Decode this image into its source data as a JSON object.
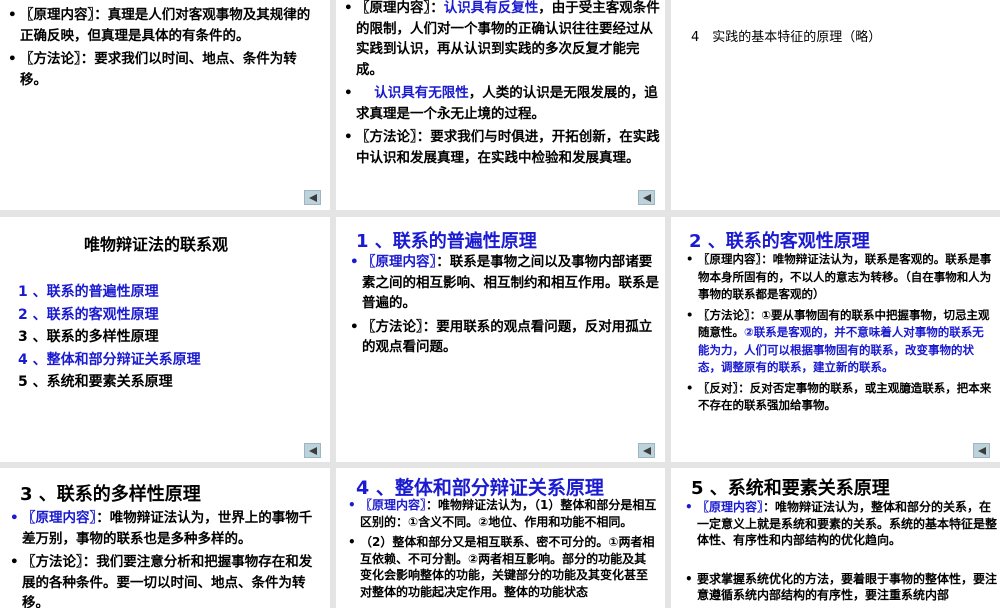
{
  "slides": [
    {
      "bullets": [
        [
          {
            "t": "〖原理内容〗：真理是人们对客观事物及其规律的正确反映，但真理是具体的有条件的。",
            "b": false
          }
        ],
        [
          {
            "t": "〖方法论〗：要求我们以时间、地点、条件为转移。",
            "b": false
          }
        ]
      ]
    },
    {
      "bullets": [
        [
          {
            "t": "〖原理内容〗：",
            "b": false
          },
          {
            "t": "认识具有反复性",
            "b": true
          },
          {
            "t": "，由于受主客观条件的限制，人们对一个事物的正确认识往往要经过从实践到认识，再从认识到实践的多次反复才能完成。",
            "b": false
          }
        ],
        [
          {
            "t": "　 ",
            "b": false
          },
          {
            "t": "认识具有无限性",
            "b": true
          },
          {
            "t": "，人类的认识是无限发展的，追求真理是一个永无止境的过程。",
            "b": false
          }
        ],
        [
          {
            "t": "〖方法论〗：要求我们与时俱进，开拓创新，在实践中认识和发展真理，在实践中检验和发展真理。",
            "b": false
          }
        ]
      ]
    },
    {
      "text": "4　实践的基本特征的原理（略）"
    },
    {
      "title": "唯物辩证法的联系观",
      "items": [
        {
          "t": "1 、联系的普遍性原理",
          "b": true
        },
        {
          "t": "2 、联系的客观性原理",
          "b": true
        },
        {
          "t": "3 、联系的多样性原理",
          "b": false
        },
        {
          "t": "4 、整体和部分辩证关系原理",
          "b": true
        },
        {
          "t": "5 、系统和要素关系原理",
          "b": false
        }
      ]
    },
    {
      "title": "1 、联系的普遍性原理",
      "bullets": [
        [
          {
            "t": "〖原理内容〗",
            "b": true
          },
          {
            "t": "：联系是事物之间以及事物内部诸要素之间的相互影响、相互制约和相互作用。联系是普遍的。",
            "b": false
          }
        ],
        [
          {
            "t": "〖方法论〗：要用联系的观点看问题，反对用孤立的观点看问题。",
            "b": false
          }
        ]
      ]
    },
    {
      "title": "2 、联系的客观性原理",
      "bullets": [
        [
          {
            "t": "〖原理内容〗：唯物辩证法认为，联系是客观的。联系是事物本身所固有的，不以人的意志为转移。（自在事物和人为事物的联系都是客观的）",
            "b": false
          }
        ],
        [
          {
            "t": "〖方法论〗：①要从事物固有的联系中把握事物，切忌主观随意性。",
            "b": false
          },
          {
            "t": "②联系是客观的，并不意味着人对事物的联系无能为力，人们可以根据事物固有的联系，改变事物的状态，调整原有的联系，建立新的联系。",
            "b": true
          }
        ],
        [
          {
            "t": "〖反对〗：反对否定事物的联系，或主观臆造联系，把本来不存在的联系强加给事物。",
            "b": false
          }
        ]
      ]
    },
    {
      "title": "3 、联系的多样性原理",
      "bullets": [
        [
          {
            "t": "〖原理内容〗",
            "b": true
          },
          {
            "t": "：唯物辩证法认为，世界上的事物千差万别，事物的联系也是多种多样的。",
            "b": false
          }
        ],
        [
          {
            "t": "〖方法论〗：我们要注意分析和把握事物存在和发展的各种条件。要一切以时间、地点、条件为转移。",
            "b": false
          }
        ]
      ]
    },
    {
      "title": "4 、整体和部分辩证关系原理",
      "bullets": [
        [
          {
            "t": "〖原理内容〗",
            "b": true
          },
          {
            "t": "：唯物辩证法认为，（1）整体和部分是相互区别的：①含义不同。②地位、作用和功能不相同。",
            "b": false
          }
        ],
        [
          {
            "t": "（2）整体和部分又是相互联系、密不可分的。①两者相互依赖、不可分割。②两者相互影响。部分的功能及其变化会影响整体的功能，关键部分的功能及其变化甚至对整体的功能起决定作用。整体的功能状态",
            "b": false
          }
        ]
      ]
    },
    {
      "title": "5 、系统和要素关系原理",
      "bullets": [
        [
          {
            "t": "〖原理内容〗",
            "b": true
          },
          {
            "t": "：唯物辩证法认为，整体和部分的关系，在一定意义上就是系统和要素的关系。系统的基本特征是整体性、有序性和内部结构的优化趋向。",
            "b": false
          }
        ],
        [
          {
            "t": "要求掌握系统优化的方法，要着眼于事物的整体性，要注意遵循系统内部结构的有序性，要注重系统内部",
            "b": false
          }
        ]
      ]
    }
  ],
  "colors": {
    "accent_blue": "#1a1ad0",
    "back_button": "#bcd3dc"
  },
  "icons": {
    "back": "back-arrow-icon"
  }
}
